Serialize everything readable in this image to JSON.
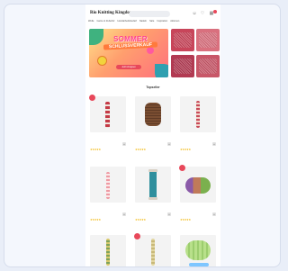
{
  "header": {
    "logo": "Rio Knitting Kingdom",
    "search_placeholder": "",
    "icons": [
      "user-icon",
      "heart-icon",
      "cart-icon"
    ],
    "cart_count": ""
  },
  "nav": {
    "items": [
      "Wolle",
      "Garne & Zubehör",
      "Handarbeitsbedarf",
      "Nadeln",
      "Sale",
      "Inspiration",
      "Aktionen"
    ]
  },
  "hero": {
    "title": "SOMMER",
    "subtitle": "SCHLUSSVERKAUF",
    "button": "Jetzt shoppen",
    "tiles": [
      "",
      "",
      "",
      ""
    ]
  },
  "section": {
    "title": "Topseller"
  },
  "products": [
    {
      "name": "",
      "price": "",
      "badge": "",
      "link": ""
    },
    {
      "name": "",
      "price": "",
      "badge": "",
      "link": ""
    },
    {
      "name": "",
      "price": "",
      "badge": "",
      "link": ""
    },
    {
      "name": "",
      "price": "",
      "badge": "",
      "link": ""
    },
    {
      "name": "",
      "price": "",
      "badge": "",
      "link": ""
    },
    {
      "name": "",
      "price": "",
      "badge": "",
      "link": ""
    },
    {
      "name": "",
      "price": "",
      "badge": "",
      "link": ""
    },
    {
      "name": "",
      "price": "",
      "badge": "",
      "link": ""
    },
    {
      "name": "",
      "price": "",
      "badge": "",
      "link": ""
    }
  ],
  "colors": {
    "accent": "#e8485a",
    "star": "#f0b400",
    "page_bg": "#e9eef8"
  }
}
